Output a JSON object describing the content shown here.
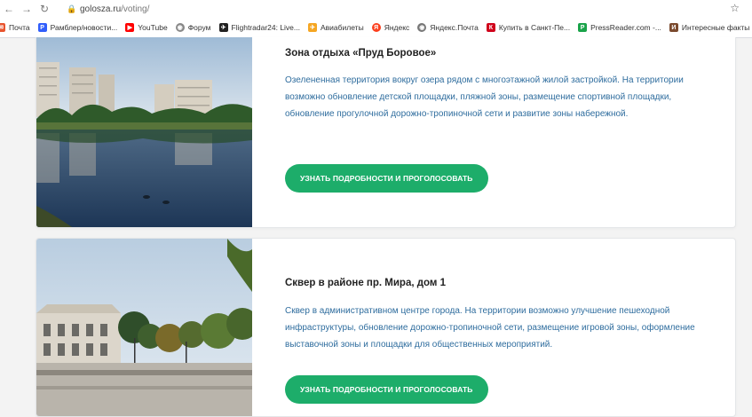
{
  "browser": {
    "url_domain": "golosza.ru",
    "url_path": "/voting/",
    "nav": {
      "back": "←",
      "forward": "→",
      "reload": "↻"
    },
    "star": "☆"
  },
  "bookmarks": [
    {
      "label": "Почта",
      "icon": "mail-icon",
      "color": "#e8542f"
    },
    {
      "label": "Рамблер/новости...",
      "icon": "rambler-icon",
      "color": "#315efb"
    },
    {
      "label": "YouTube",
      "icon": "youtube-icon",
      "color": "#ff0000"
    },
    {
      "label": "Форум",
      "icon": "forum-icon",
      "color": "#888888"
    },
    {
      "label": "Flightradar24: Live...",
      "icon": "flightradar-icon",
      "color": "#222222"
    },
    {
      "label": "Авиабилеты",
      "icon": "plane-icon",
      "color": "#f5a623"
    },
    {
      "label": "Яндекс",
      "icon": "yandex-icon",
      "color": "#fc3f1d"
    },
    {
      "label": "Яндекс.Почта",
      "icon": "yandex-mail-icon",
      "color": "#777777"
    },
    {
      "label": "Купить в Санкт-Пе...",
      "icon": "shop-icon",
      "color": "#d0021b"
    },
    {
      "label": "PressReader.com -...",
      "icon": "pressreader-icon",
      "color": "#1aa34a"
    },
    {
      "label": "Интересные факты",
      "icon": "facts-icon",
      "color": "#7b4a2e"
    }
  ],
  "projects": [
    {
      "title": "Зона отдыха «Пруд Боровое»",
      "description": "Озелененная территория вокруг озера рядом с многоэтажной жилой застройкой. На территории возможно обновление детской площадки, пляжной зоны, размещение спортивной площадки, обновление прогулочной дорожно-тропиночной сети и развитие зоны набережной.",
      "button": "УЗНАТЬ ПОДРОБНОСТИ И ПРОГОЛОСОВАТЬ"
    },
    {
      "title": "Сквер в районе пр. Мира, дом 1",
      "description": "Сквер в административном центре города. На территории возможно улучшение пешеходной инфраструктуры, обновление дорожно-тропиночной сети, размещение игровой зоны, оформление выставочной зоны и площадки для общественных мероприятий.",
      "button": "УЗНАТЬ ПОДРОБНОСТИ И ПРОГОЛОСОВАТЬ"
    }
  ],
  "colors": {
    "accent_button": "#1dad6a",
    "description_text": "#2f6d9e",
    "page_background": "#f3f3f3"
  }
}
